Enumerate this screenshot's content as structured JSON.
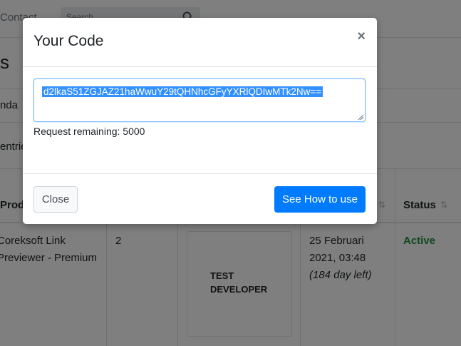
{
  "background": {
    "nav": {
      "contact_label": "Contact",
      "search_placeholder": "Search"
    },
    "page_title": "s",
    "crumb": "nda",
    "entries_label": "entries",
    "table": {
      "headers": {
        "product": "Produ",
        "status": "Status"
      },
      "row": {
        "product": "Coreksoft Link\nPreviewer - Premium",
        "qty": "2",
        "thumb_text": "TEST\nDEVELOPER",
        "expiry_date": "25 Februari\n2021, 03:48",
        "days_left": "(184 day left)",
        "status": "Active"
      }
    }
  },
  "modal": {
    "title": "Your Code",
    "close_symbol": "×",
    "code": "d2lkaS51ZGJAZ21haWwuY29tQHNhcGFyYXRlQDIwMTk2Nw==",
    "remaining": "Request remaining: 5000",
    "close_button": "Close",
    "primary_button": "See How to use",
    "colors": {
      "primary": "#007bff",
      "selection": "#3390ff",
      "active": "#1e8e3e"
    }
  }
}
